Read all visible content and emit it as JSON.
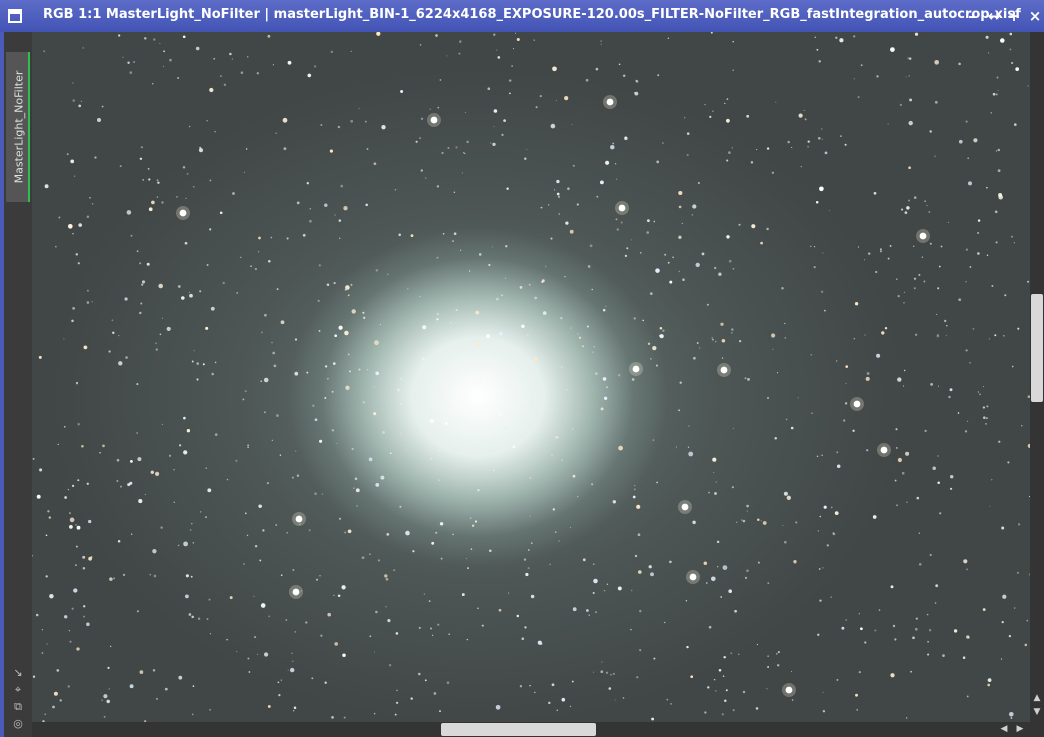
{
  "window": {
    "title": "RGB 1:1 MasterLight_NoFilter | masterLight_BIN-1_6224x4168_EXPOSURE-120.00s_FILTER-NoFilter_RGB_fastIntegration_autocrop.xisf",
    "controls": {
      "minimize": "–",
      "shade": "↔",
      "maximize": "+",
      "close": "×"
    }
  },
  "side_panel": {
    "view_tab_label": "MasterLight_NoFilter",
    "tools": [
      {
        "icon": "resize-arrow-icon",
        "glyph": "↘"
      },
      {
        "icon": "fit-view-icon",
        "glyph": "⌖"
      },
      {
        "icon": "clone-view-icon",
        "glyph": "⧉"
      },
      {
        "icon": "target-icon",
        "glyph": "◎"
      }
    ]
  },
  "image": {
    "description_type": "astrophoto",
    "zoom": "1:1",
    "color_mode": "RGB"
  },
  "scrollbars": {
    "vertical_position": 0.37,
    "horizontal_position": 0.41,
    "up_arrow": "▲",
    "down_arrow": "▼",
    "left_arrow": "◀",
    "right_arrow": "▶"
  },
  "colors": {
    "titlebar": "#4b5bb9",
    "active_tab_indicator": "#2fbf4f"
  }
}
